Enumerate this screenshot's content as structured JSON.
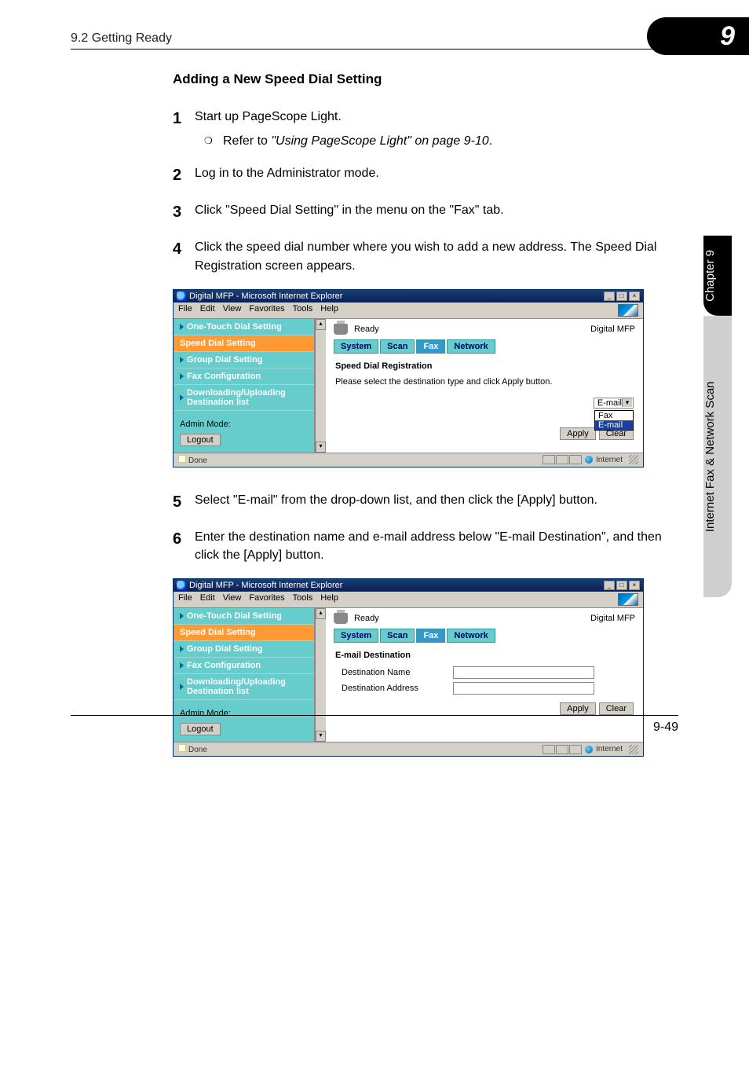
{
  "header": {
    "left": "9.2 Getting Ready",
    "badge": "9"
  },
  "sideTab": {
    "black": "Chapter 9",
    "gray": "Internet Fax & Network Scan"
  },
  "section_title": "Adding a New Speed Dial Setting",
  "steps": {
    "1": {
      "num": "1",
      "text": "Start up PageScope Light.",
      "sub": {
        "prefix": "Refer to ",
        "ref": "\"Using PageScope Light\" on page 9-10",
        "suffix": "."
      }
    },
    "2": {
      "num": "2",
      "text": "Log in to the Administrator mode."
    },
    "3": {
      "num": "3",
      "text": "Click \"Speed Dial Setting\" in the menu on the \"Fax\" tab."
    },
    "4": {
      "num": "4",
      "text": "Click the speed dial number where you wish to add a new address. The Speed Dial Registration screen appears."
    },
    "5": {
      "num": "5",
      "text": "Select \"E-mail\" from the drop-down list, and then click the [Apply] button."
    },
    "6": {
      "num": "6",
      "text": "Enter the destination name and e-mail address below \"E-mail Destination\", and then click the [Apply] button."
    }
  },
  "browser": {
    "title": "Digital MFP - Microsoft Internet Explorer",
    "menus": [
      "File",
      "Edit",
      "View",
      "Favorites",
      "Tools",
      "Help"
    ],
    "status_ready": "Ready",
    "brand": "Digital MFP",
    "tabs": [
      "System",
      "Scan",
      "Fax",
      "Network"
    ],
    "sidebar": {
      "items": [
        "One-Touch Dial Setting",
        "Speed Dial Setting",
        "Group Dial Setting",
        "Fax Configuration",
        "Downloading/Uploading Destination list"
      ],
      "admin_label": "Admin Mode:",
      "logout": "Logout"
    },
    "statusbar_done": "Done",
    "statusbar_internet": "Internet",
    "screen1": {
      "title": "Speed Dial Registration",
      "text": "Please select the destination type and click Apply button.",
      "select_value": "E-mail",
      "options": [
        "Fax",
        "E-mail"
      ],
      "apply": "Apply",
      "clear": "Clear"
    },
    "screen2": {
      "title": "E-mail Destination",
      "field1": "Destination Name",
      "field2": "Destination Address",
      "apply": "Apply",
      "clear": "Clear"
    },
    "winbtns": {
      "min": "_",
      "max": "□",
      "close": "×"
    }
  },
  "footer": "9-49"
}
